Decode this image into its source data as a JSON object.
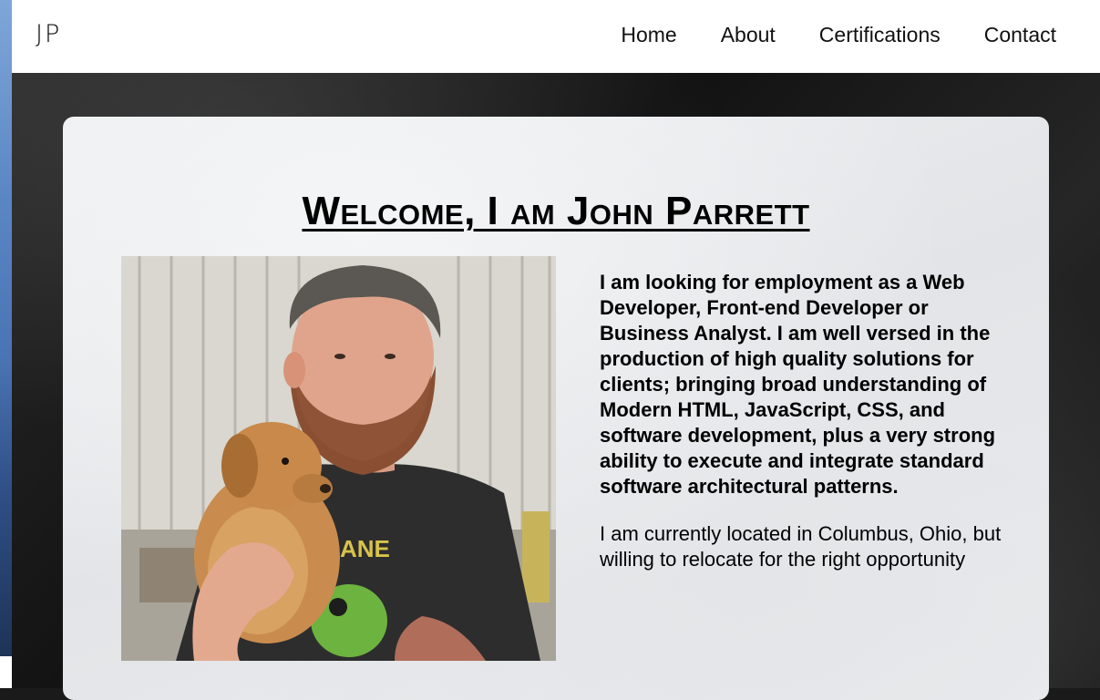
{
  "navbar": {
    "brand": "JP",
    "links": [
      "Home",
      "About",
      "Certifications",
      "Contact"
    ]
  },
  "hero": {
    "title": "Welcome, I am John Parrett",
    "photo_alt": "John Parrett holding a puppy",
    "bio_paragraph_1": "I am looking for employment as a Web Developer, Front-end Developer or Business Analyst. I am well versed in the production of high quality solutions for clients; bringing broad understanding of Modern HTML, JavaScript, CSS, and software development, plus a very strong ability to execute and integrate standard software architectural patterns.",
    "bio_paragraph_2": "I am currently located in Columbus, Ohio, but willing to relocate for the right opportunity"
  },
  "colors": {
    "navbar_bg": "#ffffff",
    "card_bg": "#e9ebed",
    "text": "#000000",
    "page_bg": "#1a1a1a"
  }
}
